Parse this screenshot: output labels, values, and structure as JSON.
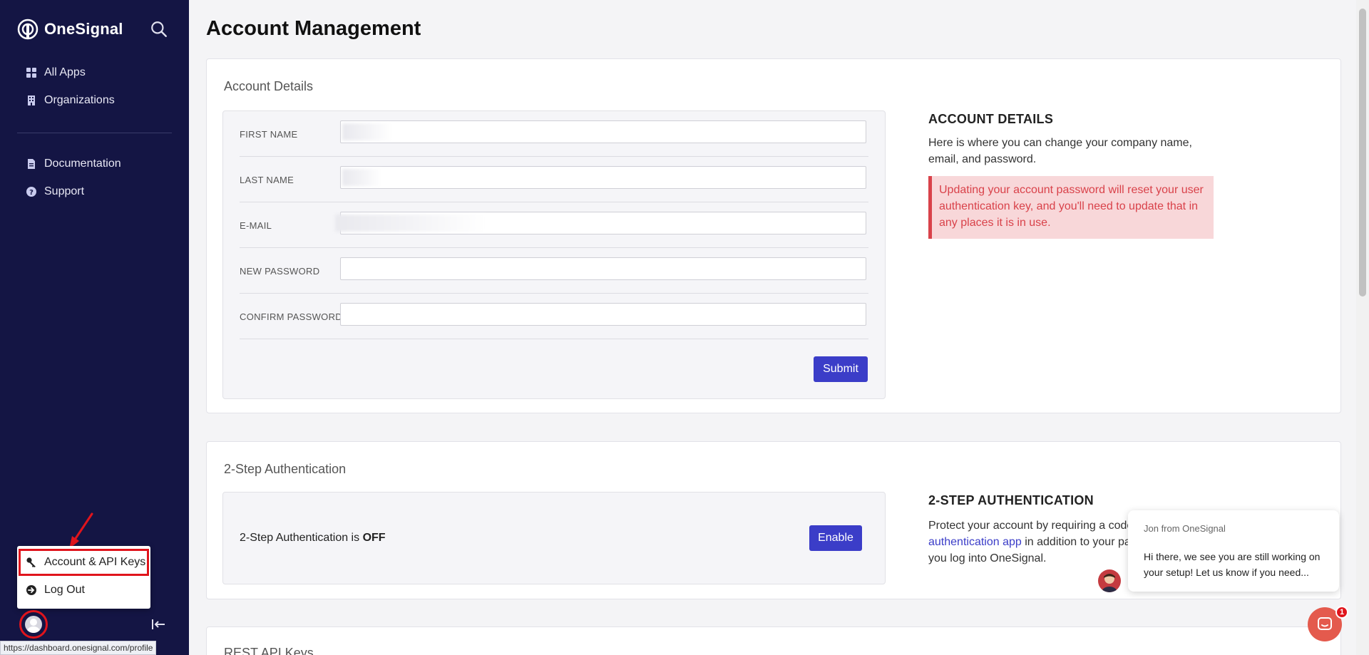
{
  "brand": {
    "name": "OneSignal"
  },
  "sidebar": {
    "nav_primary": [
      {
        "label": "All Apps",
        "icon": "grid-icon"
      },
      {
        "label": "Organizations",
        "icon": "building-icon"
      }
    ],
    "nav_secondary": [
      {
        "label": "Documentation",
        "icon": "document-icon"
      },
      {
        "label": "Support",
        "icon": "question-circle-icon"
      }
    ],
    "popup": {
      "items": [
        {
          "label": "Account & API Keys",
          "icon": "key-icon"
        },
        {
          "label": "Log Out",
          "icon": "logout-icon"
        }
      ]
    },
    "status_url": "https://dashboard.onesignal.com/profile"
  },
  "page": {
    "title": "Account Management"
  },
  "account_details": {
    "title": "Account Details",
    "fields": [
      {
        "label": "FIRST NAME",
        "value": ""
      },
      {
        "label": "LAST NAME",
        "value": ""
      },
      {
        "label": "E-MAIL",
        "value": ""
      },
      {
        "label": "NEW PASSWORD",
        "value": ""
      },
      {
        "label": "CONFIRM PASSWORD",
        "value": ""
      }
    ],
    "submit_label": "Submit",
    "info_heading": "ACCOUNT DETAILS",
    "info_text": "Here is where you can change your company name, email, and password.",
    "alert_text": "Updating your account password will reset your user authentication key, and you'll need to update that in any places it is in use."
  },
  "two_step": {
    "title": "2-Step Authentication",
    "status_prefix": "2-Step Authentication is ",
    "status_value": "OFF",
    "enable_label": "Enable",
    "info_heading": "2-STEP AUTHENTICATION",
    "info_line1": "Protect your account by requiring a code fr",
    "info_link": "authentication app",
    "info_line2_rest": " in addition to your pass",
    "info_line3": "you log into OneSignal."
  },
  "rest_api": {
    "title": "REST API Keys"
  },
  "chat": {
    "from": "Jon from OneSignal",
    "message": "Hi there, we see you are still working on your setup! Let us know if you need...",
    "badge_count": "1"
  },
  "colors": {
    "sidebar_bg": "#141544",
    "primary": "#3b3dc8",
    "alert": "#d9424a",
    "highlight": "#e0141c"
  }
}
